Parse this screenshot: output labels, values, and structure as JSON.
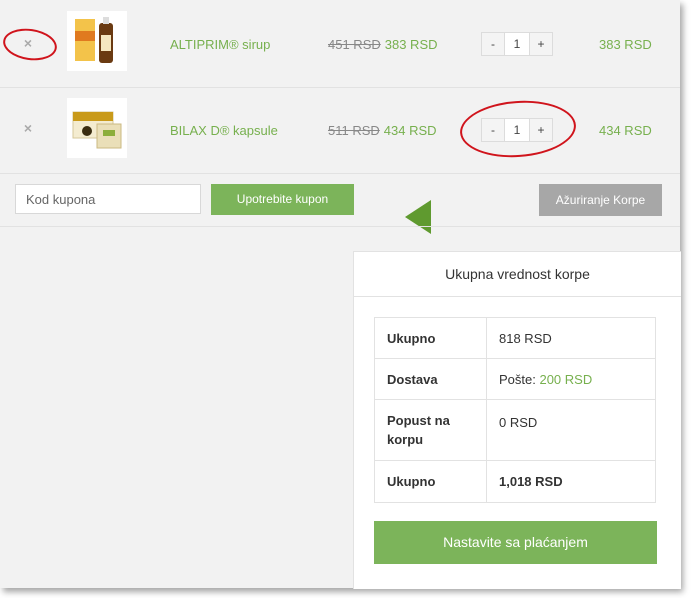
{
  "cart": {
    "items": [
      {
        "remove_icon": "×",
        "name": "ALTIPRIM® sirup",
        "old_price": "451 RSD",
        "new_price": "383 RSD",
        "qty_minus": "-",
        "quantity": "1",
        "qty_plus": "+",
        "subtotal": "383 RSD"
      },
      {
        "remove_icon": "×",
        "name": "BILAX D® kapsule",
        "old_price": "511 RSD",
        "new_price": "434 RSD",
        "qty_minus": "-",
        "quantity": "1",
        "qty_plus": "+",
        "subtotal": "434 RSD"
      }
    ],
    "coupon_placeholder": "Kod kupona",
    "apply_coupon_label": "Upotrebite kupon",
    "update_cart_label": "Ažuriranje Korpe"
  },
  "totals": {
    "title": "Ukupna vrednost korpe",
    "rows": [
      {
        "label": "Ukupno",
        "value": "818 RSD"
      },
      {
        "label": "Dostava",
        "prefix": "Pošte: ",
        "value": "200 RSD"
      },
      {
        "label": "Popust na korpu",
        "value": "0 RSD"
      },
      {
        "label": "Ukupno",
        "value": "1,018 RSD"
      }
    ],
    "checkout_label": "Nastavite sa plaćanjem"
  },
  "colors": {
    "accent": "#7cb45a",
    "link_green": "#77b04e",
    "annotation_red": "#d0141c",
    "arrow_green": "#5f9a2f"
  }
}
